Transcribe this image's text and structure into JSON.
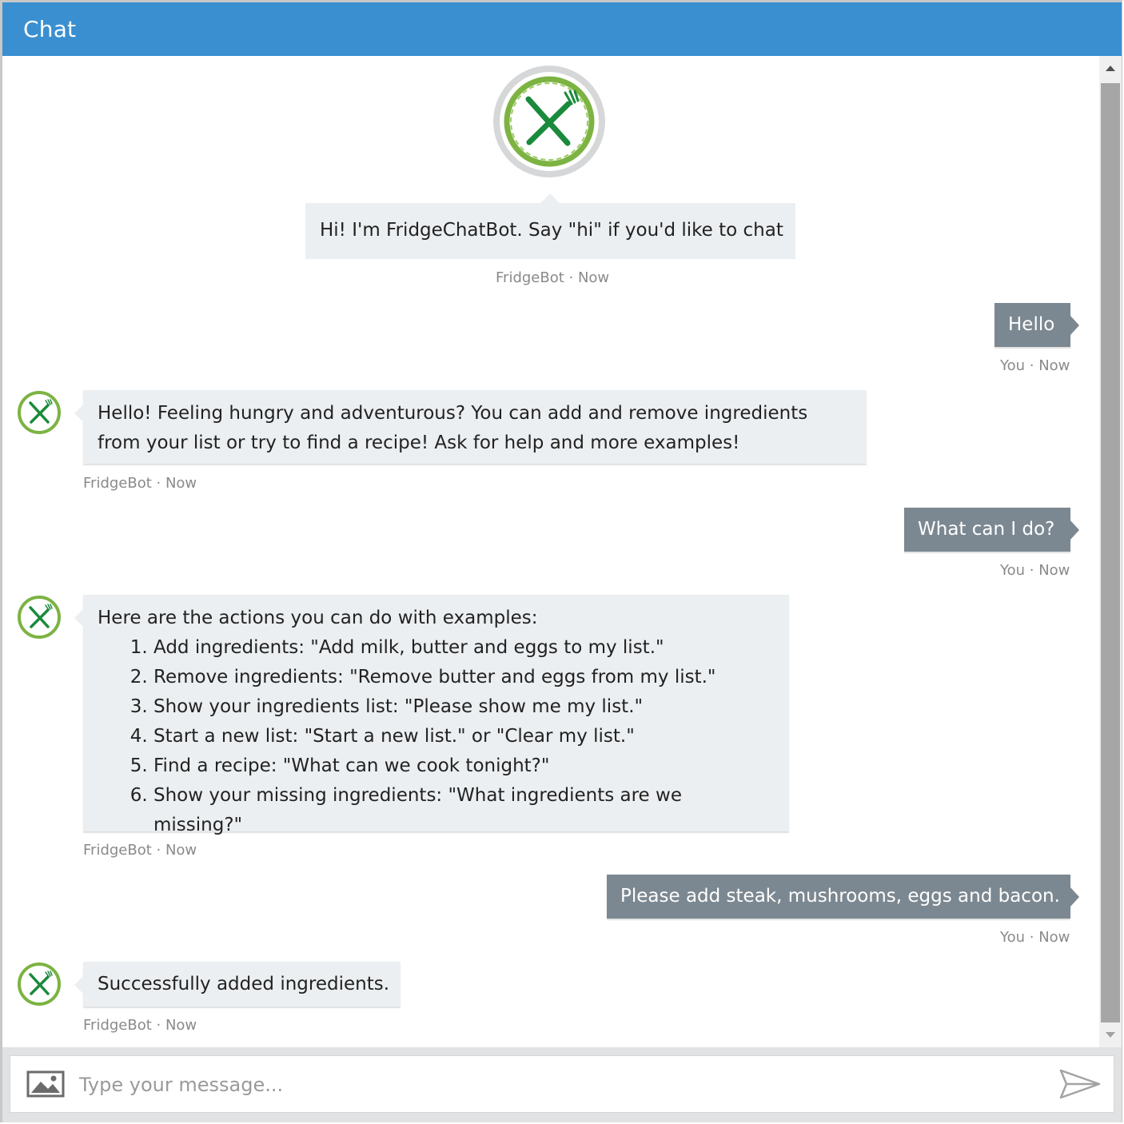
{
  "header": {
    "title": "Chat"
  },
  "welcome": {
    "text": "Hi! I'm FridgeChatBot. Say \"hi\" if you'd like to chat",
    "meta": "FridgeBot · Now"
  },
  "messages": {
    "u1": {
      "text": "Hello",
      "meta": "You · Now"
    },
    "b1": {
      "line1": "Hello! Feeling hungry and adventurous? You can add and remove ingredients",
      "line2": "from your list or try to find a recipe! Ask for help and more examples!",
      "meta": "FridgeBot · Now"
    },
    "u2": {
      "text": "What can I do?",
      "meta": "You · Now"
    },
    "b2": {
      "intro": "Here are the actions you can do with examples:",
      "items": [
        "Add ingredients: \"Add milk, butter and eggs to my list.\"",
        "Remove ingredients: \"Remove butter and eggs from my list.\"",
        "Show your ingredients list: \"Please show me my list.\"",
        "Start a new list: \"Start a new list.\" or \"Clear my list.\"",
        "Find a recipe: \"What can we cook tonight?\"",
        "Show your missing ingredients: \"What ingredients are we missing?\""
      ],
      "meta": "FridgeBot · Now"
    },
    "u3": {
      "text": "Please add steak, mushrooms, eggs and bacon.",
      "meta": "You · Now"
    },
    "b3": {
      "text": "Successfully added ingredients.",
      "meta": "FridgeBot · Now"
    }
  },
  "composer": {
    "placeholder": "Type your message..."
  },
  "icons": {
    "avatar": "fork-knife-logo-icon",
    "upload": "image-icon",
    "send": "send-icon"
  },
  "colors": {
    "header": "#3a8fd0",
    "bot_bubble": "#eceff1",
    "user_bubble": "#7c8891",
    "logo_green": "#1a8a3c",
    "logo_ring": "#7cb342"
  }
}
